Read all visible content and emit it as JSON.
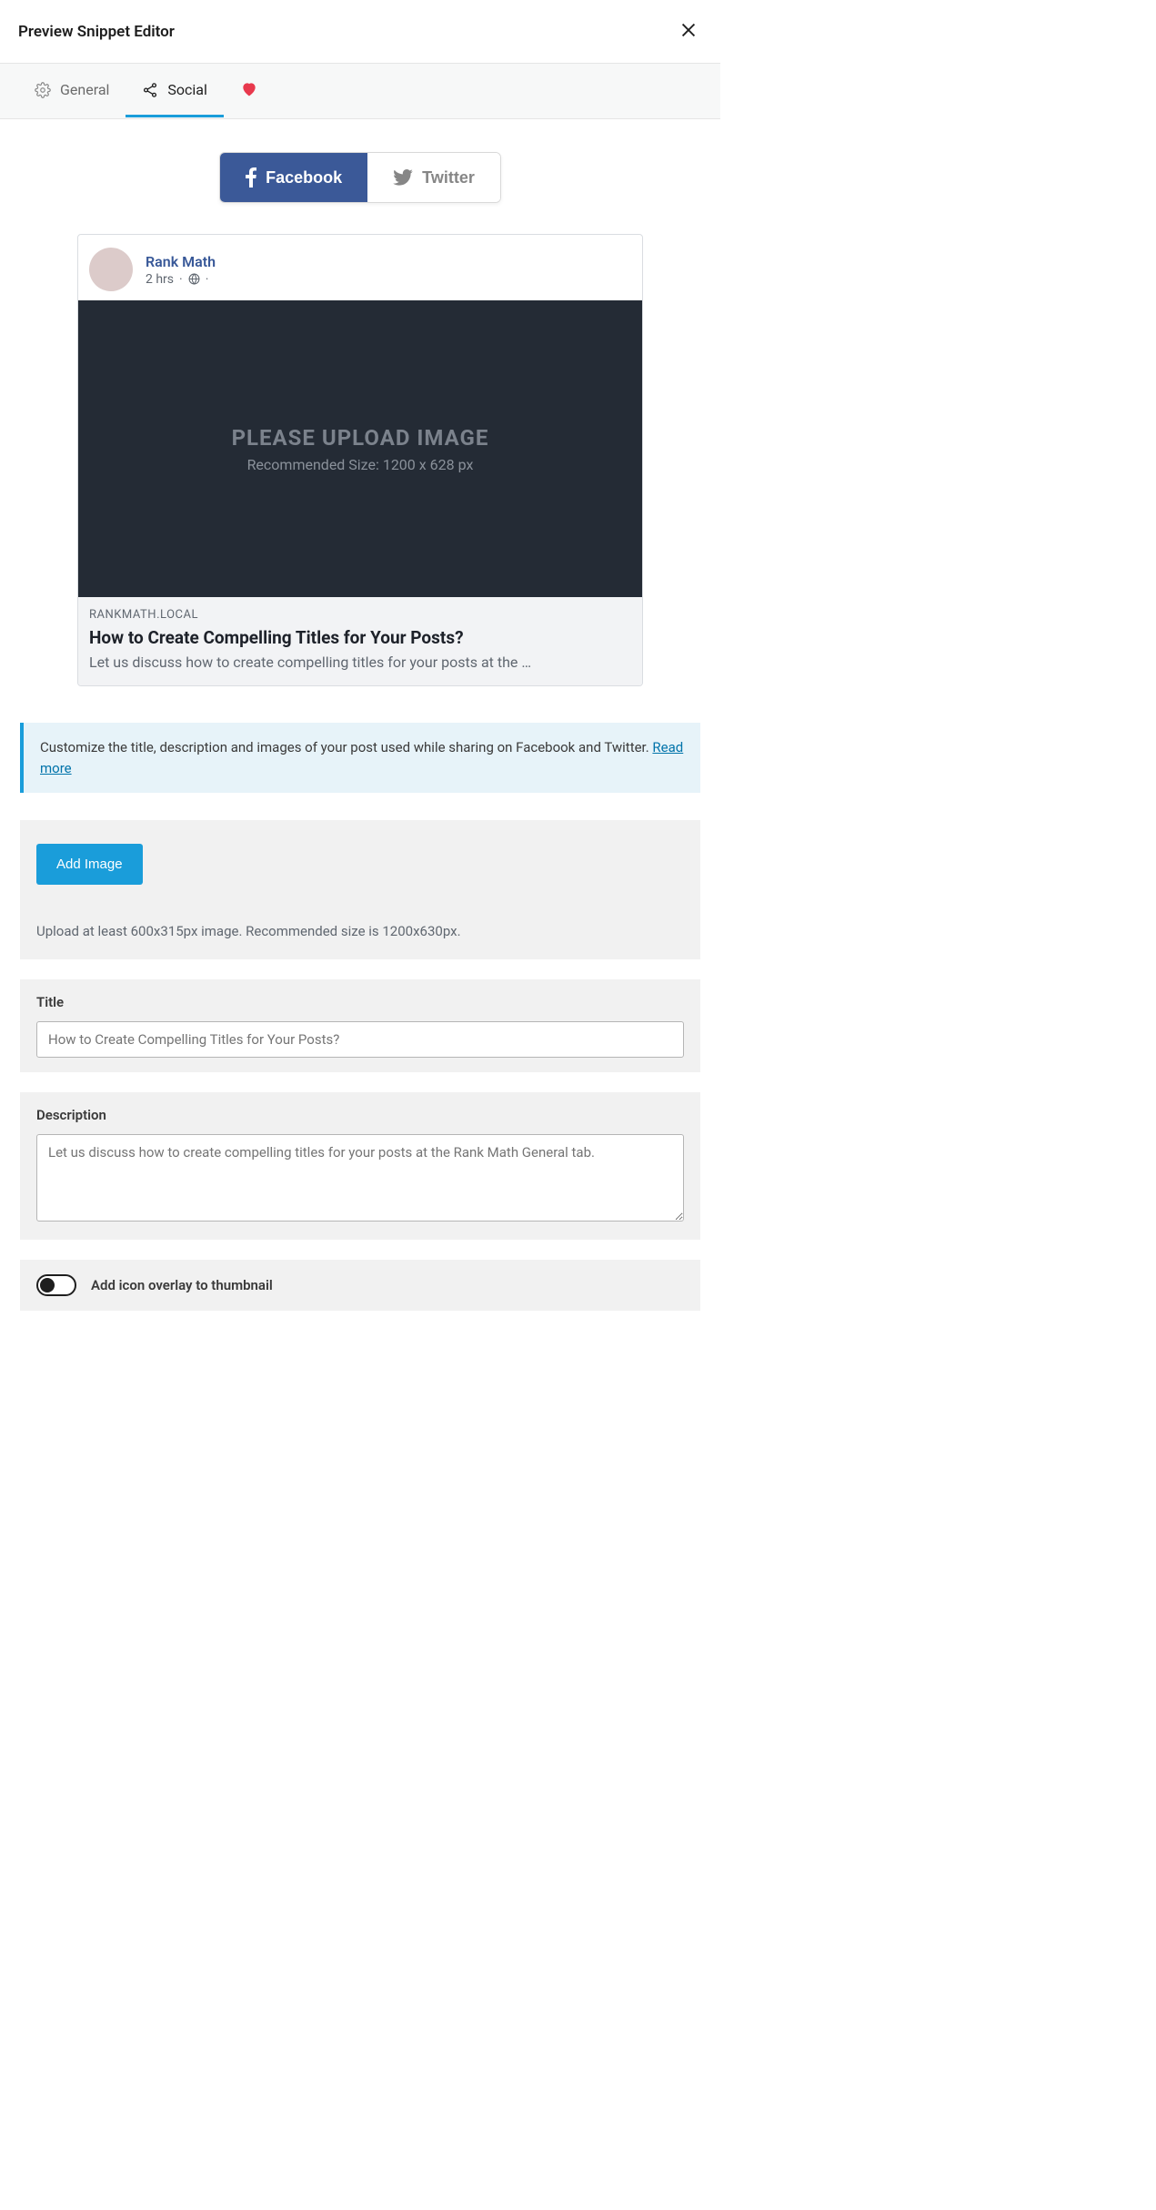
{
  "header": {
    "title": "Preview Snippet Editor"
  },
  "tabs": {
    "general": "General",
    "social": "Social"
  },
  "social_buttons": {
    "facebook": "Facebook",
    "twitter": "Twitter"
  },
  "preview": {
    "author": "Rank Math",
    "time": "2 hrs",
    "image_line1": "PLEASE UPLOAD IMAGE",
    "image_line2": "Recommended Size: 1200 x 628 px",
    "domain": "RANKMATH.LOCAL",
    "title": "How to Create Compelling Titles for Your Posts?",
    "description": "Let us discuss how to create compelling titles for your posts at the …"
  },
  "info": {
    "text": "Customize the title, description and images of your post used while sharing on Facebook and Twitter. ",
    "link": "Read more"
  },
  "image_panel": {
    "button": "Add Image",
    "helper": "Upload at least 600x315px image. Recommended size is 1200x630px."
  },
  "title_panel": {
    "label": "Title",
    "placeholder": "How to Create Compelling Titles for Your Posts?"
  },
  "desc_panel": {
    "label": "Description",
    "placeholder": "Let us discuss how to create compelling titles for your posts at the Rank Math General tab."
  },
  "overlay_panel": {
    "label": "Add icon overlay to thumbnail"
  }
}
